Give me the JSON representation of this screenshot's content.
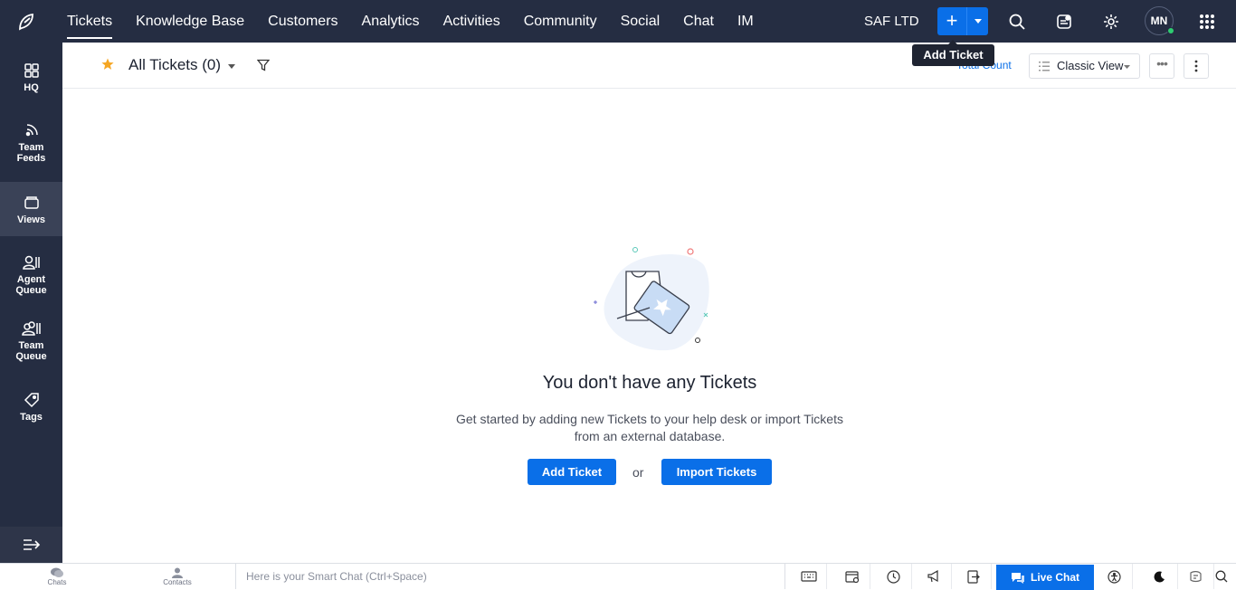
{
  "topbar": {
    "nav": [
      {
        "label": "Tickets",
        "active": true
      },
      {
        "label": "Knowledge Base"
      },
      {
        "label": "Customers"
      },
      {
        "label": "Analytics"
      },
      {
        "label": "Activities"
      },
      {
        "label": "Community"
      },
      {
        "label": "Social"
      },
      {
        "label": "Chat"
      },
      {
        "label": "IM"
      }
    ],
    "org_name": "SAF LTD",
    "add_plus": "+",
    "avatar_initials": "MN",
    "tooltip": "Add Ticket",
    "icons": [
      "logo-icon",
      "plus-icon",
      "chevron-down-icon",
      "search-icon",
      "notes-icon",
      "gear-icon",
      "apps-grid-icon"
    ]
  },
  "sidebar": {
    "items": [
      {
        "label": "HQ",
        "icon": "grid-icon"
      },
      {
        "label": "Team Feeds",
        "icon": "feed-icon"
      },
      {
        "label": "Views",
        "icon": "folder-icon",
        "active": true
      },
      {
        "label": "Agent Queue",
        "icon": "agent-icon"
      },
      {
        "label": "Team Queue",
        "icon": "team-icon"
      },
      {
        "label": "Tags",
        "icon": "tag-icon"
      }
    ],
    "collapse_icon": "expand-arrow-icon"
  },
  "subbar": {
    "title": "All Tickets (0)",
    "total_count": "Total Count",
    "view_mode": "Classic View",
    "more": "•••"
  },
  "empty_state": {
    "title": "You don't have any Tickets",
    "description": "Get started by adding new Tickets to your help desk or import Tickets from an external database.",
    "add_button": "Add Ticket",
    "or": "or",
    "import_button": "Import Tickets"
  },
  "bottombar": {
    "chats": "Chats",
    "contacts": "Contacts",
    "smart_chat_placeholder": "Here is your Smart Chat (Ctrl+Space)",
    "live_chat": "Live Chat",
    "colors": {
      "primary": "#0a6fe8",
      "nav_bg": "#252d42"
    }
  }
}
